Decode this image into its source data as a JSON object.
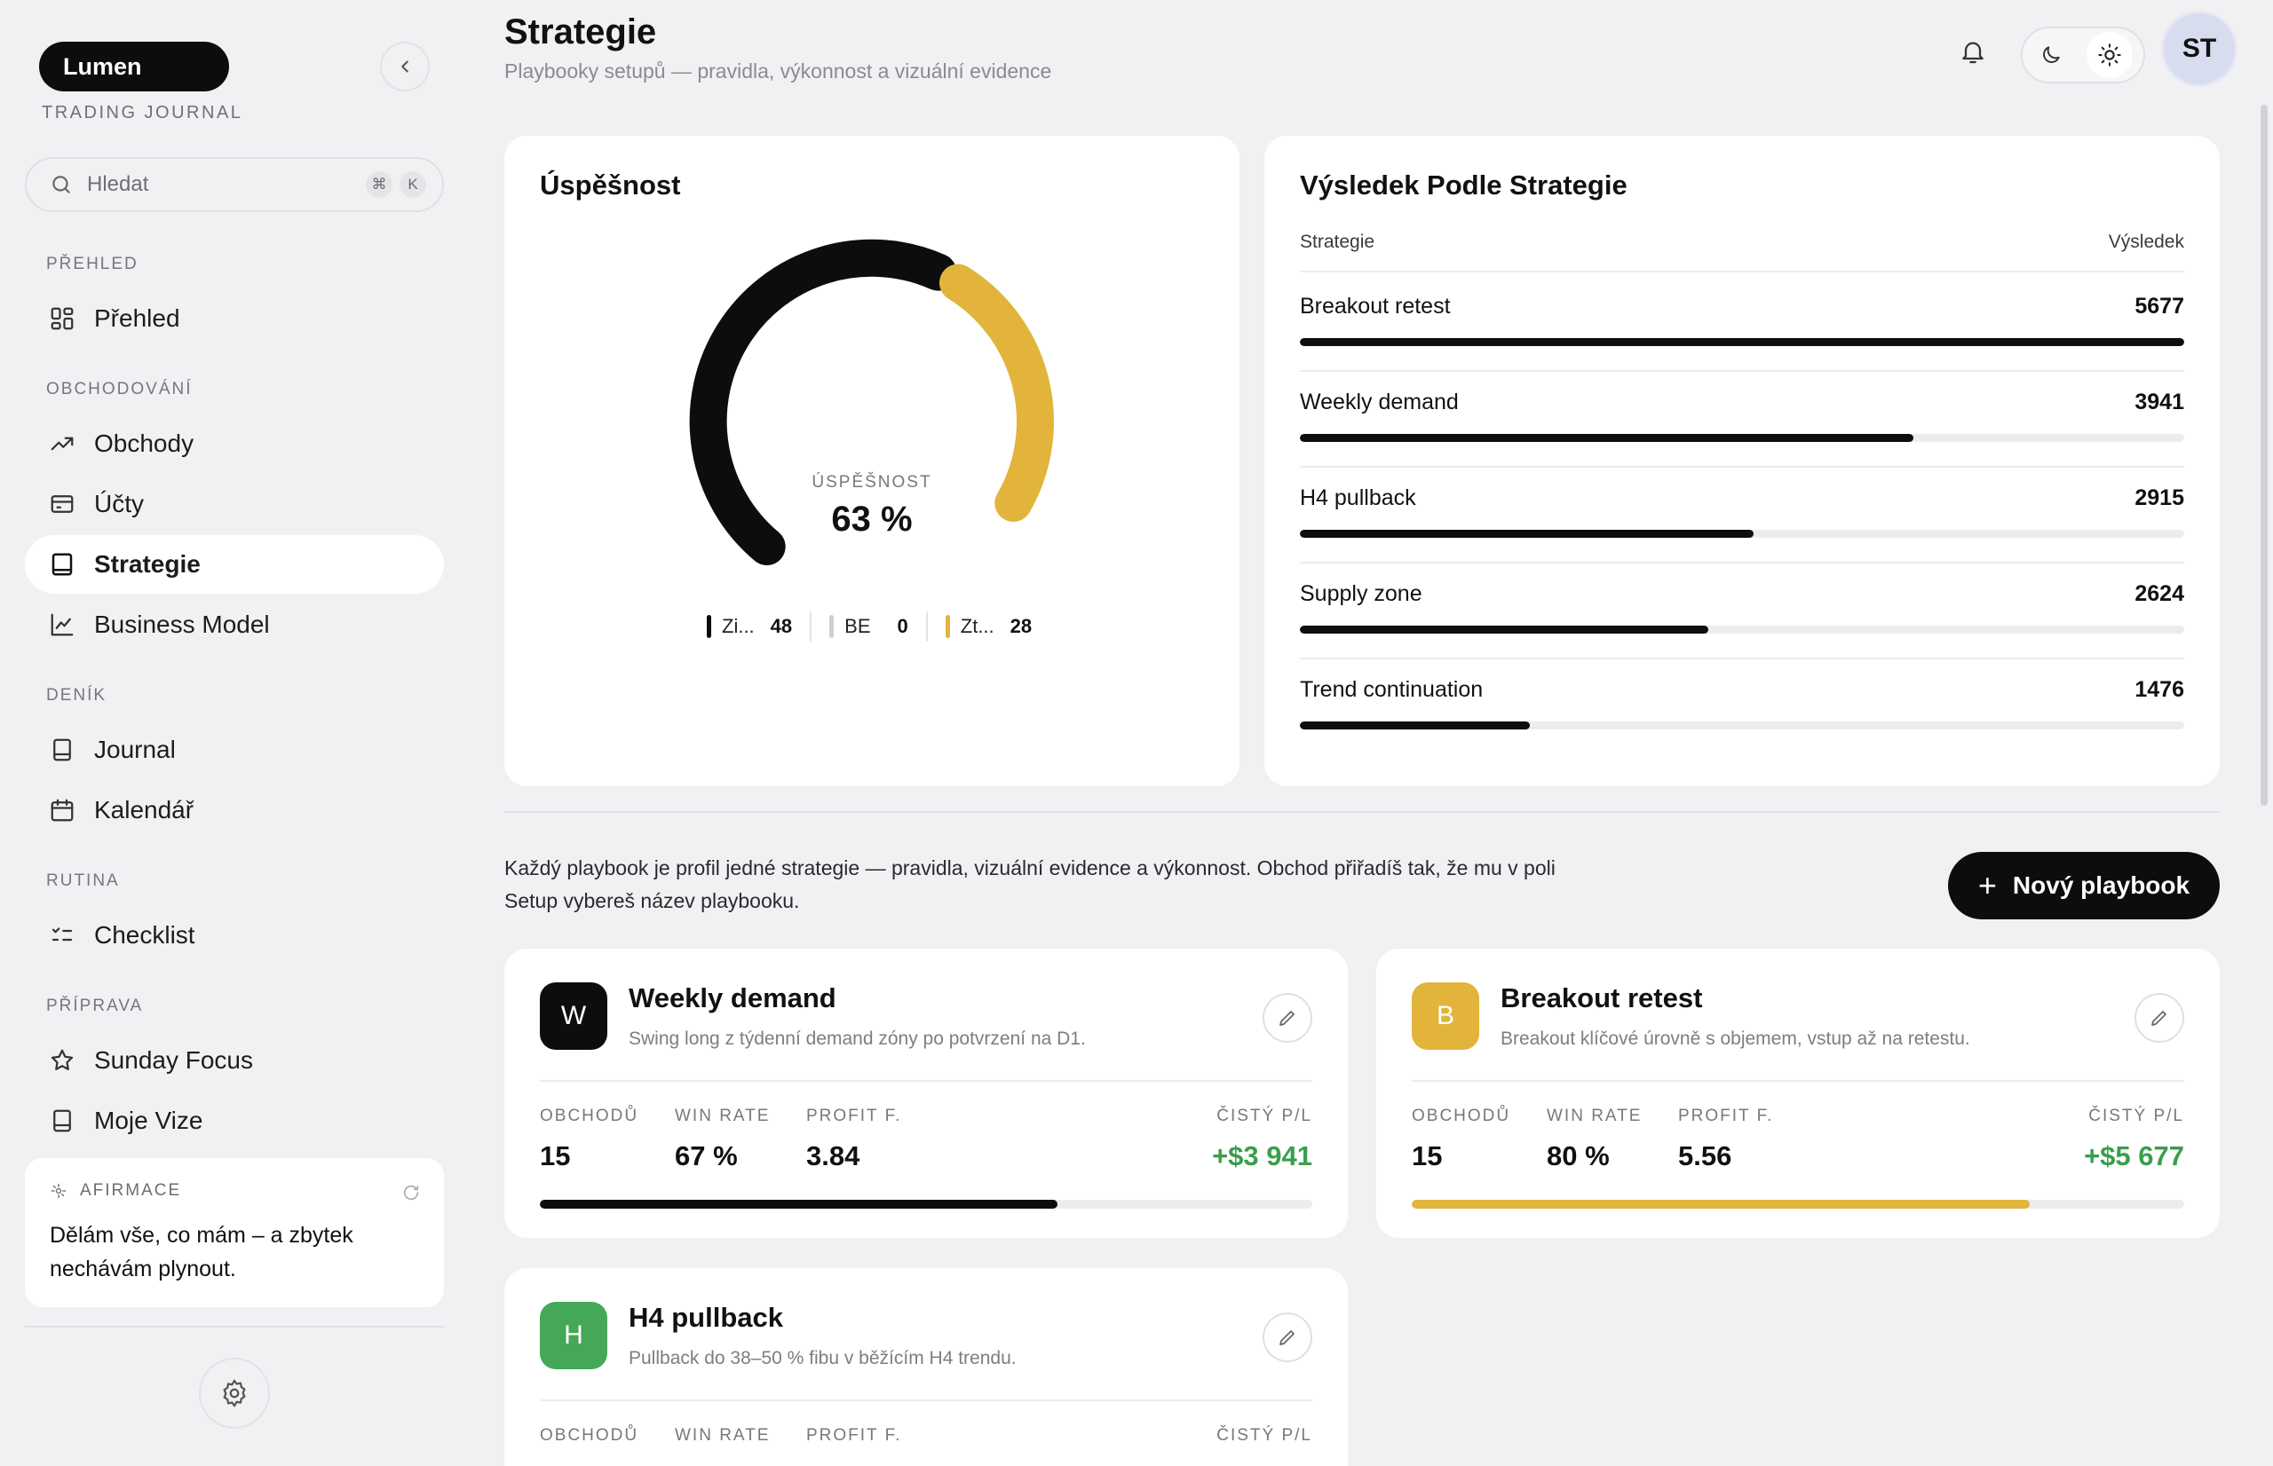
{
  "brand": {
    "name": "Lumen",
    "subtitle": "TRADING JOURNAL"
  },
  "search": {
    "placeholder": "Hledat",
    "kbd": [
      "⌘",
      "K"
    ]
  },
  "sidebar": {
    "sections": {
      "prehled": "PŘEHLED",
      "obchodovani": "OBCHODOVÁNÍ",
      "denik": "DENÍK",
      "rutina": "RUTINA",
      "priprava": "PŘÍPRAVA"
    },
    "items": {
      "prehled": "Přehled",
      "obchody": "Obchody",
      "ucty": "Účty",
      "strategie": "Strategie",
      "business_model": "Business Model",
      "journal": "Journal",
      "kalendar": "Kalendář",
      "checklist": "Checklist",
      "sunday_focus": "Sunday Focus",
      "moje_vize": "Moje Vize"
    },
    "active_item": "strategie",
    "affirmation": {
      "label": "AFIRMACE",
      "text": "Dělám vše, co mám – a zbytek nechávám plynout."
    }
  },
  "header": {
    "title": "Strategie",
    "subtitle": "Playbooky setupů — pravidla, výkonnost a vizuální evidence",
    "user_initials": "ST",
    "theme": "light"
  },
  "success_card": {
    "title": "Úspěšnost",
    "gauge_label": "ÚSPĚŠNOST",
    "gauge_value": "63 %",
    "gauge_fraction": 0.63,
    "legend": [
      {
        "name": "Zi...",
        "value": "48",
        "color": "#0d0d0d"
      },
      {
        "name": "BE",
        "value": "0",
        "color": "#cfcfd3"
      },
      {
        "name": "Zt...",
        "value": "28",
        "color": "#e2b43c"
      }
    ]
  },
  "results_card": {
    "title": "Výsledek Podle Strategie",
    "col_strategy": "Strategie",
    "col_result": "Výsledek",
    "rows": [
      {
        "name": "Breakout retest",
        "value": "5677",
        "fraction": 1.0
      },
      {
        "name": "Weekly demand",
        "value": "3941",
        "fraction": 0.694
      },
      {
        "name": "H4 pullback",
        "value": "2915",
        "fraction": 0.513
      },
      {
        "name": "Supply zone",
        "value": "2624",
        "fraction": 0.462
      },
      {
        "name": "Trend continuation",
        "value": "1476",
        "fraction": 0.26
      }
    ]
  },
  "playbooks_intro": "Každý playbook je profil jedné strategie — pravidla, vizuální evidence a výkonnost. Obchod přiřadíš tak, že mu v poli Setup vybereš název playbooku.",
  "new_playbook_label": "Nový playbook",
  "stat_labels": {
    "trades": "OBCHODŮ",
    "win_rate": "WIN RATE",
    "profit_factor": "PROFIT F.",
    "net_pl": "ČISTÝ P/L"
  },
  "playbooks": [
    {
      "letter": "W",
      "name": "Weekly demand",
      "desc": "Swing long z týdenní demand zóny po potvrzení na D1.",
      "trades": "15",
      "win_rate": "67 %",
      "profit_factor": "3.84",
      "net_pl": "+$3 941",
      "color": "#0d0d0d",
      "progress": 0.67
    },
    {
      "letter": "B",
      "name": "Breakout retest",
      "desc": "Breakout klíčové úrovně s objemem, vstup až na retestu.",
      "trades": "15",
      "win_rate": "80 %",
      "profit_factor": "5.56",
      "net_pl": "+$5 677",
      "color": "#e2b43c",
      "progress": 0.8
    },
    {
      "letter": "H",
      "name": "H4 pullback",
      "desc": "Pullback do 38–50 % fibu v běžícím H4 trendu.",
      "color": "#45a858"
    }
  ]
}
